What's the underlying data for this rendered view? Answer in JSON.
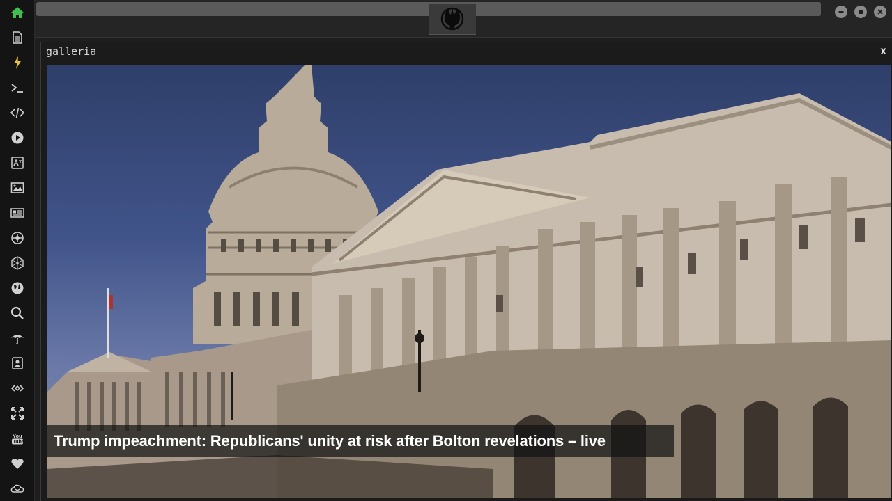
{
  "sidebar": {
    "items": [
      {
        "name": "home-icon",
        "color": "#3fbf4f"
      },
      {
        "name": "document-icon"
      },
      {
        "name": "lightning-icon",
        "color": "#e6c33a"
      },
      {
        "name": "terminal-icon"
      },
      {
        "name": "code-icon"
      },
      {
        "name": "play-icon"
      },
      {
        "name": "translate-icon"
      },
      {
        "name": "image-icon"
      },
      {
        "name": "news-icon"
      },
      {
        "name": "settings-icon"
      },
      {
        "name": "hexagon-icon"
      },
      {
        "name": "globe-icon"
      },
      {
        "name": "search-icon"
      },
      {
        "name": "umbrella-icon"
      },
      {
        "name": "contact-icon"
      },
      {
        "name": "link-icon"
      },
      {
        "name": "expand-icon"
      },
      {
        "name": "youtube-icon"
      },
      {
        "name": "heart-icon"
      },
      {
        "name": "cloud-icon"
      }
    ]
  },
  "window": {
    "title": "galleria",
    "close_label": "x"
  },
  "gallery": {
    "caption": "Trump impeachment: Republicans' unity at risk after Bolton revelations – live"
  },
  "colors": {
    "accent_home": "#3fbf4f",
    "accent_bolt": "#e6c33a"
  }
}
